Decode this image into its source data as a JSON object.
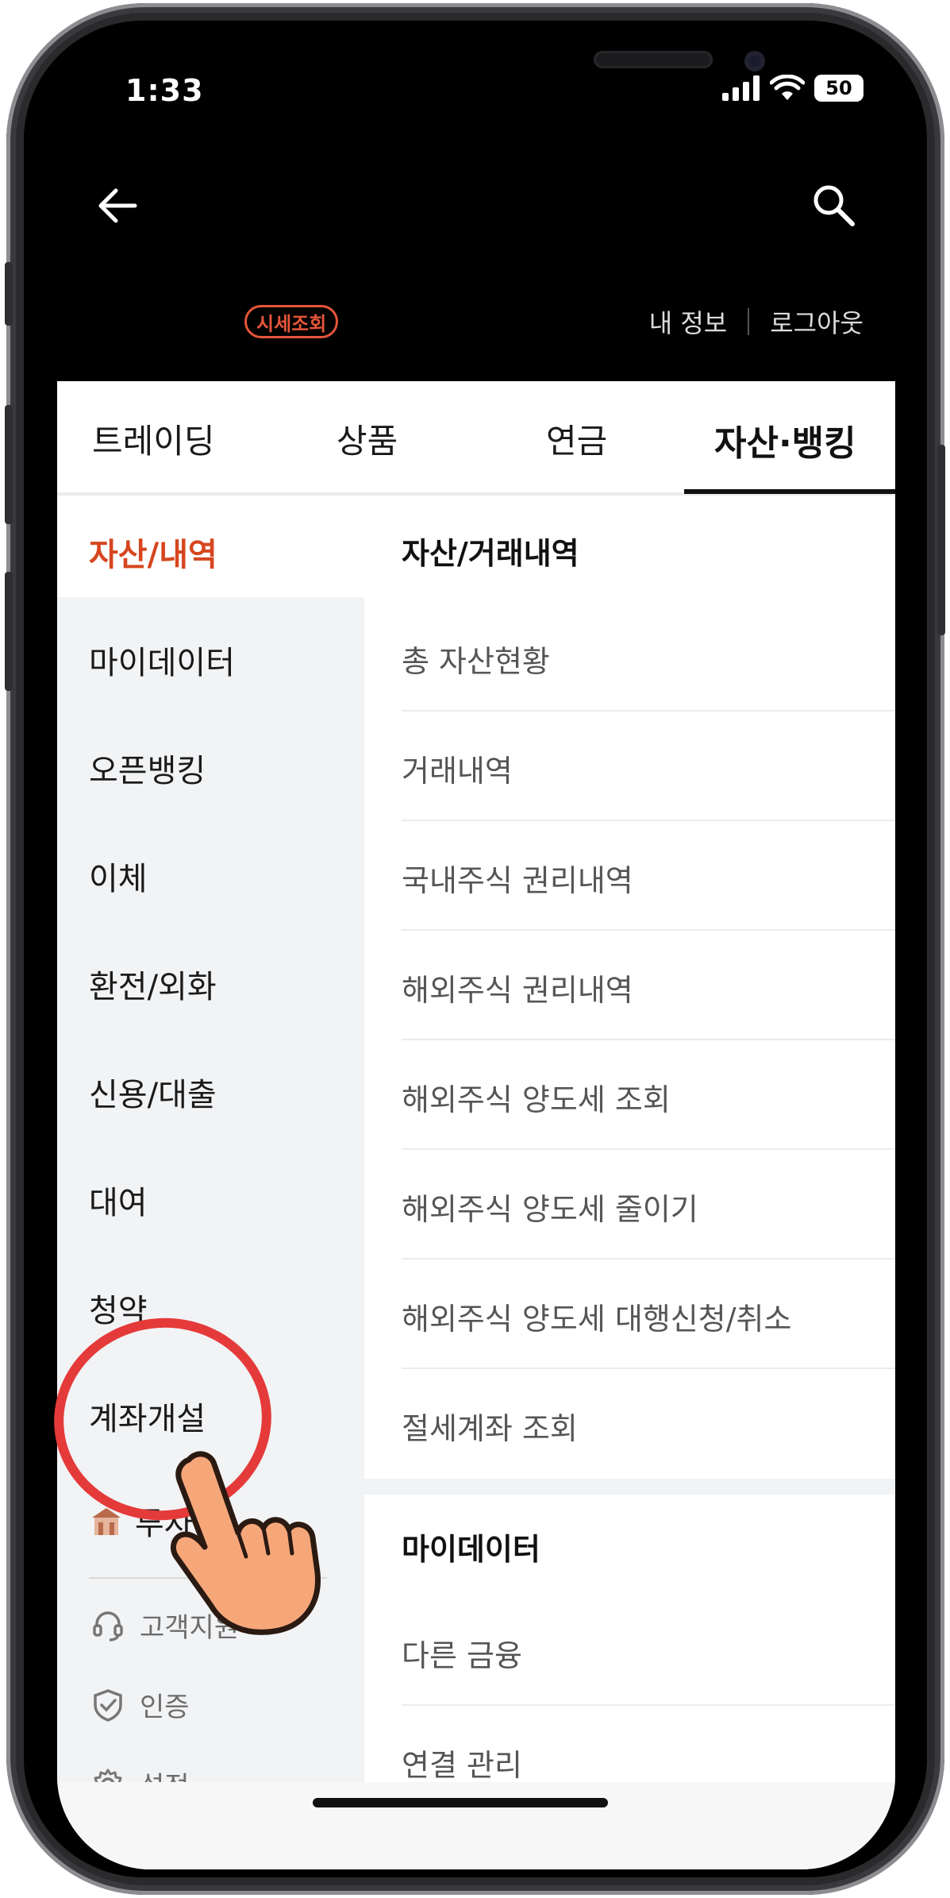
{
  "status_bar": {
    "time": "1:33",
    "battery": "50"
  },
  "header": {
    "badge": "시세조회",
    "my_info": "내 정보",
    "logout": "로그아웃"
  },
  "tabs": [
    {
      "label": "트레이딩"
    },
    {
      "label": "상품"
    },
    {
      "label": "연금"
    },
    {
      "label": "자산·뱅킹"
    }
  ],
  "sidebar": {
    "items": [
      {
        "label": "자산/내역"
      },
      {
        "label": "마이데이터"
      },
      {
        "label": "오픈뱅킹"
      },
      {
        "label": "이체"
      },
      {
        "label": "환전/외화"
      },
      {
        "label": "신용/대출"
      },
      {
        "label": "대여"
      },
      {
        "label": "청약"
      },
      {
        "label": "계좌개설"
      },
      {
        "label": "투자"
      }
    ],
    "footer": [
      {
        "label": "고객지원",
        "icon": "headset-icon"
      },
      {
        "label": "인증",
        "icon": "shield-check-icon"
      },
      {
        "label": "설정",
        "icon": "gear-icon"
      }
    ]
  },
  "main": {
    "section1": {
      "title": "자산/거래내역",
      "items": [
        "총 자산현황",
        "거래내역",
        "국내주식 권리내역",
        "해외주식 권리내역",
        "해외주식 양도세 조회",
        "해외주식 양도세 줄이기",
        "해외주식 양도세 대행신청/취소",
        "절세계좌 조회"
      ]
    },
    "section2": {
      "title": "마이데이터",
      "items": [
        "다른 금융",
        "연결 관리"
      ]
    }
  },
  "colors": {
    "accent": "#d6461f",
    "badge": "#e5553a",
    "highlight": "#e53a3a",
    "hand": "#f6a77a"
  }
}
